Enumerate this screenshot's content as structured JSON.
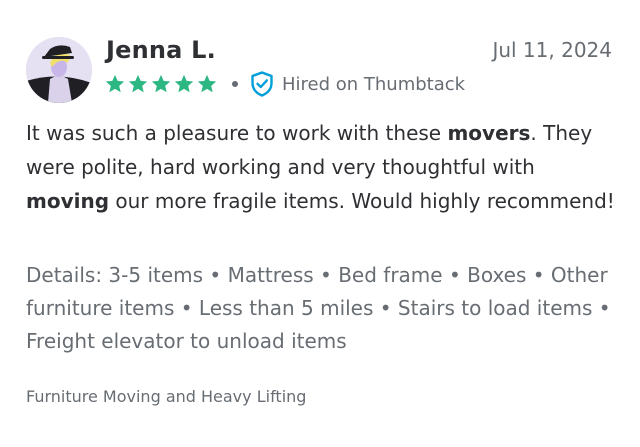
{
  "review": {
    "reviewer_name": "Jenna L.",
    "date": "Jul 11, 2024",
    "rating": 5,
    "rating_max": 5,
    "star_color": "#2db783",
    "verified_icon": "shield-check-icon",
    "verified_color": "#009fd9",
    "hired_label": "Hired on Thumbtack",
    "body": {
      "seg1": "It was such a pleasure to work with these ",
      "bold1": "movers",
      "seg2": ". They were polite, hard working and very thoughtful with ",
      "bold2": "moving",
      "seg3": " our more fragile items. Would highly recommend!"
    },
    "details": "Details: 3-5 items • Mattress • Bed frame • Boxes • Other furniture items • Less than 5 miles • Stairs to load items • Freight elevator to unload items",
    "category": "Furniture Moving and Heavy Lifting"
  }
}
